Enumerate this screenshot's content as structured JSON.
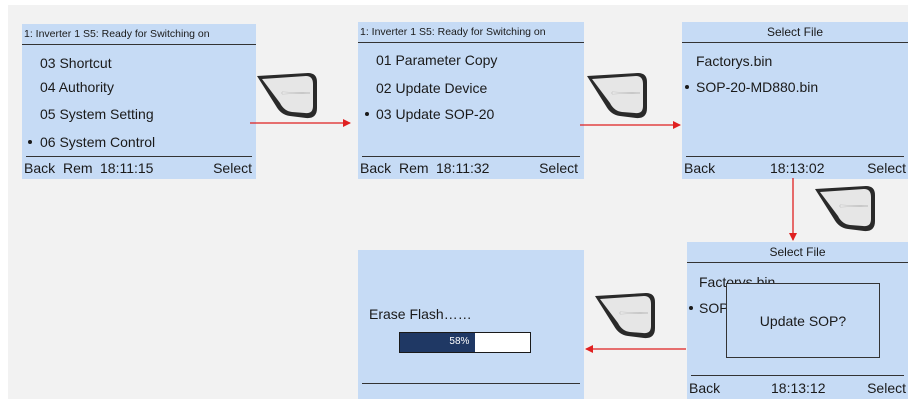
{
  "colors": {
    "screen_bg": "#c6dbf5",
    "arrow": "#e02020",
    "progress_fill": "#1f3864"
  },
  "screens": [
    {
      "header": "1: Inverter 1   S5: Ready for Switching on",
      "items": [
        "03 Shortcut",
        "04 Authority",
        "05 System Setting",
        "06 System Control"
      ],
      "selected_index": 3,
      "footer": {
        "left": "Back",
        "mode": "Rem",
        "time": "18:11:15",
        "right": "Select"
      }
    },
    {
      "header": "1: Inverter 1   S5: Ready for Switching on",
      "items": [
        "01 Parameter Copy",
        "02 Update Device",
        "03 Update SOP-20"
      ],
      "selected_index": 2,
      "footer": {
        "left": "Back",
        "mode": "Rem",
        "time": "18:11:32",
        "right": "Select"
      }
    },
    {
      "header": "Select File",
      "items": [
        "Factorys.bin",
        "SOP-20-MD880.bin"
      ],
      "selected_index": 1,
      "footer": {
        "left": "Back",
        "time": "18:13:02",
        "right": "Select"
      }
    },
    {
      "header": "Select File",
      "items": [
        "Factorys.bin",
        "SOP"
      ],
      "selected_index": 1,
      "dialog": "Update SOP?",
      "footer": {
        "left": "Back",
        "time": "18:13:12",
        "right": "Select"
      }
    },
    {
      "status": "Erase Flash……",
      "progress": {
        "percent": 58,
        "label": "58%"
      }
    }
  ],
  "key_icon": "keypad-select-key-icon"
}
